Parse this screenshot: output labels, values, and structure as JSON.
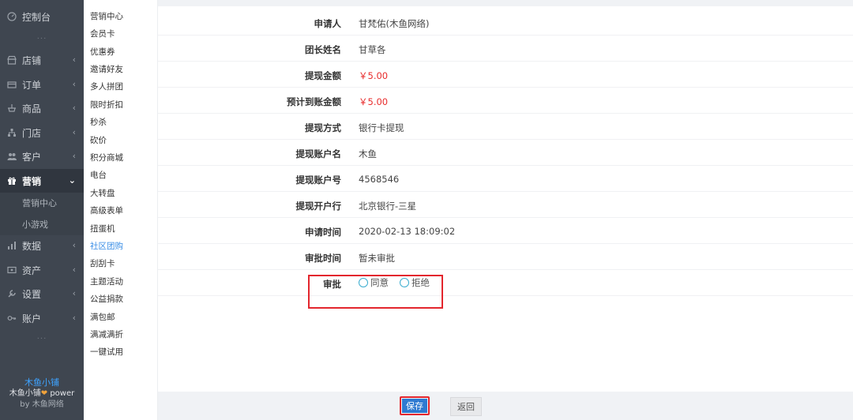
{
  "sidebar": {
    "items": [
      {
        "label": "控制台",
        "icon": "dashboard-icon"
      },
      {
        "label": "店铺",
        "icon": "shop-icon"
      },
      {
        "label": "订单",
        "icon": "order-icon"
      },
      {
        "label": "商品",
        "icon": "goods-icon"
      },
      {
        "label": "门店",
        "icon": "store-icon"
      },
      {
        "label": "客户",
        "icon": "customer-icon"
      },
      {
        "label": "营销",
        "icon": "gift-icon"
      },
      {
        "label": "数据",
        "icon": "chart-icon"
      },
      {
        "label": "资产",
        "icon": "wallet-icon"
      },
      {
        "label": "设置",
        "icon": "wrench-icon"
      },
      {
        "label": "账户",
        "icon": "key-icon"
      }
    ],
    "sub_items": [
      "营销中心",
      "小游戏"
    ],
    "dots": "···",
    "brand": {
      "name": "木鱼小铺",
      "power_prefix": "木鱼小铺",
      "power_suffix": " power",
      "by": "by 木鱼网络"
    }
  },
  "submenu": {
    "items": [
      "营销中心",
      "会员卡",
      "优惠券",
      "邀请好友",
      "多人拼团",
      "限时折扣",
      "秒杀",
      "砍价",
      "积分商城",
      "电台",
      "大转盘",
      "高级表单",
      "扭蛋机",
      "社区团购",
      "刮刮卡",
      "主题活动",
      "公益捐款",
      "满包邮",
      "满减满折",
      "一键试用"
    ],
    "active": "社区团购"
  },
  "detail": {
    "rows": [
      {
        "label": "申请人",
        "value": "甘梵佑(木鱼网络)"
      },
      {
        "label": "团长姓名",
        "value": "甘草各"
      },
      {
        "label": "提现金额",
        "value": "￥5.00"
      },
      {
        "label": "预计到账金额",
        "value": "￥5.00"
      },
      {
        "label": "提现方式",
        "value": "银行卡提现"
      },
      {
        "label": "提现账户名",
        "value": "木鱼"
      },
      {
        "label": "提现账户号",
        "value": "4568546"
      },
      {
        "label": "提现开户行",
        "value": "北京银行-三星"
      },
      {
        "label": "申请时间",
        "value": "2020-02-13 18:09:02"
      },
      {
        "label": "审批时间",
        "value": "暂未审批"
      }
    ],
    "approval": {
      "label": "审批",
      "options": [
        "同意",
        "拒绝"
      ]
    }
  },
  "footer": {
    "save_label": "保存",
    "back_label": "返回"
  },
  "colors": {
    "sidebar_bg": "#3f4650",
    "accent_blue": "#2e7ad1",
    "amount_red": "#e82c2c",
    "highlight_red": "#e3262d"
  }
}
